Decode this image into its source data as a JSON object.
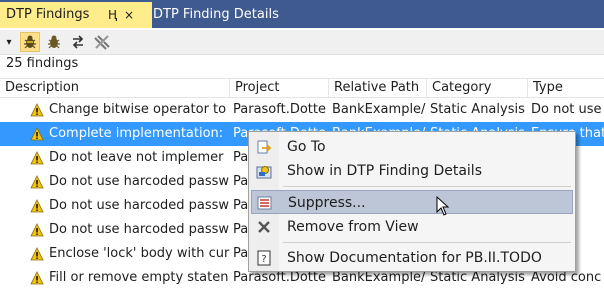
{
  "tabs": {
    "active_label": "DTP Findings",
    "inactive_label": "DTP Finding Details",
    "pin_glyph": "Ⱨ",
    "close_glyph": "×"
  },
  "toolbar": {
    "buttons": [
      {
        "name": "dropdown-icon"
      },
      {
        "name": "bug-filter-icon"
      },
      {
        "name": "bug-icon"
      },
      {
        "name": "refresh-icon"
      },
      {
        "name": "disconnect-icon"
      }
    ]
  },
  "summary": {
    "count_text": "25 findings"
  },
  "table": {
    "columns": [
      "Description",
      "Project",
      "Relative Path",
      "Category",
      "Type"
    ],
    "rows": [
      {
        "description": "Change bitwise operator to",
        "project": "Parasoft.Dotte",
        "path": "BankExample/",
        "category": "Static Analysis",
        "type": "Do not use",
        "selected": false
      },
      {
        "description": "Complete implementation:",
        "project": "Parasoft.Dotte",
        "path": "BankExample/",
        "category": "Static Analysis",
        "type": "Ensure that",
        "selected": true
      },
      {
        "description": "Do not leave not implemer",
        "project": "Pa",
        "path": "",
        "category": "",
        "type": "t lea",
        "selected": false
      },
      {
        "description": "Do not use harcoded passw",
        "project": "Pa",
        "path": "",
        "category": "",
        "type": "t use",
        "selected": false
      },
      {
        "description": "Do not use harcoded passw",
        "project": "Pa",
        "path": "",
        "category": "",
        "type": "t use",
        "selected": false
      },
      {
        "description": "Do not use harcoded passw",
        "project": "Pa",
        "path": "",
        "category": "",
        "type": "t use",
        "selected": false
      },
      {
        "description": "Enclose 'lock' body with cur",
        "project": "Pa",
        "path": "",
        "category": "",
        "type": "s enc",
        "selected": false
      },
      {
        "description": "Fill or remove empty staten",
        "project": "Parasoft.Dotte",
        "path": "BankExample/",
        "category": "Static Analysis",
        "type": "Avoid conc",
        "selected": false
      }
    ]
  },
  "context_menu": {
    "items": [
      {
        "label": "Go To",
        "icon": "goto-icon"
      },
      {
        "label": "Show in DTP Finding Details",
        "icon": "details-icon"
      },
      {
        "label": "Suppress...",
        "icon": "suppress-icon"
      },
      {
        "label": "Remove from View",
        "icon": "remove-icon"
      },
      {
        "label": "Show Documentation for PB.II.TODO",
        "icon": "documentation-icon"
      }
    ]
  },
  "colors": {
    "tab_bar": "#3f5a8f",
    "active_tab": "#ffec8b",
    "selection": "#3399ff",
    "menu_hover": "#bdc6d6",
    "warning": "#f0c419"
  }
}
